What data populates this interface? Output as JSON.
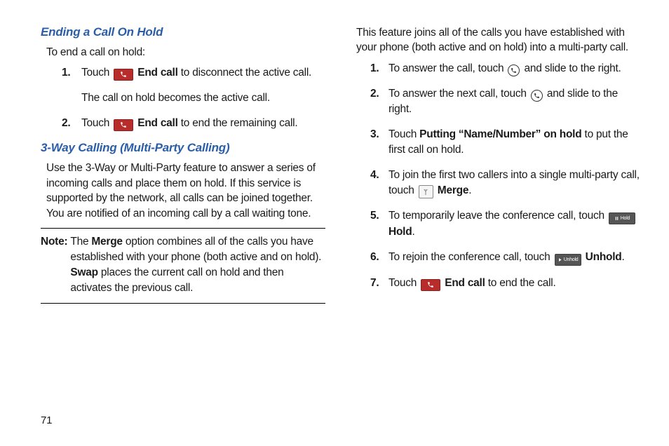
{
  "page_number": "71",
  "left": {
    "section1": {
      "heading": "Ending a Call On Hold",
      "intro": "To end a call on hold:",
      "steps": [
        {
          "pre": "Touch ",
          "bold": "End call",
          "post": " to disconnect the active call.",
          "sub": "The call on hold becomes the active call."
        },
        {
          "pre": "Touch ",
          "bold": "End call",
          "post": " to end the remaining call."
        }
      ]
    },
    "section2": {
      "heading": "3-Way Calling (Multi-Party Calling)",
      "para": "Use the 3-Way or Multi-Party feature to answer a series of incoming calls and place them on hold. If this service is supported by the network, all calls can be joined together. You are notified of an incoming call by a call waiting tone.",
      "note_label": "Note:",
      "note_pre": "The ",
      "note_b1": "Merge",
      "note_mid1": " option combines all of the calls you have established with your phone (both active and on hold). ",
      "note_b2": "Swap",
      "note_mid2": " places the current call on hold and then activates the previous call."
    }
  },
  "right": {
    "intro": "This feature joins all of the calls you have established with your phone (both active and on hold) into a multi-party call.",
    "step1": {
      "pre": "To answer the call, touch ",
      "post": " and slide to the right."
    },
    "step2": {
      "pre": "To answer the next call, touch ",
      "post": " and slide to the right."
    },
    "step3": {
      "pre": "Touch ",
      "bold": "Putting “Name/Number” on hold",
      "post": " to put the first call on hold."
    },
    "step4": {
      "pre": "To join the first two callers into a single multi-party call, touch ",
      "bold": "Merge",
      "post": "."
    },
    "step5": {
      "pre": "To temporarily leave the conference call, touch ",
      "bold": "Hold",
      "post": "."
    },
    "step6": {
      "pre": "To rejoin the conference call, touch ",
      "bold": "Unhold",
      "post": "."
    },
    "step7": {
      "pre": "Touch ",
      "bold": "End call",
      "post": " to end the call."
    },
    "hold_btn_label": "Hold",
    "unhold_btn_label": "Unhold"
  }
}
